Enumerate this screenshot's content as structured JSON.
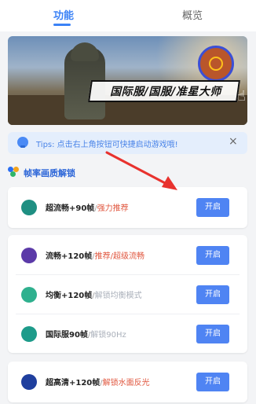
{
  "tabs": {
    "function": "功能",
    "overview": "概览"
  },
  "banner": {
    "title": "国际服/国服/准星大师"
  },
  "tips": {
    "text": "Tips: 点击右上角按钮可快捷启动游戏哦!",
    "close": "×"
  },
  "section": {
    "title": "帧率画质解锁"
  },
  "items": [
    {
      "name": "超流畅+90帧",
      "desc": "强力推荐",
      "desc_style": "hot",
      "button": "开启",
      "color": "#1f8f82"
    },
    {
      "name": "流畅+120帧",
      "desc": "推荐/超级流畅",
      "desc_style": "hot",
      "button": "开启",
      "color": "#5b3aa8"
    },
    {
      "name": "均衡+120帧",
      "desc": "解锁均衡模式",
      "desc_style": "muted",
      "button": "开启",
      "color": "#2fb08e"
    },
    {
      "name": "国际服90帧",
      "desc": "解锁90Hz",
      "desc_style": "muted",
      "button": "开启",
      "color": "#1d9b8a"
    },
    {
      "name": "超高清+120帧",
      "desc": "解锁水面反光",
      "desc_style": "hot",
      "button": "开启",
      "color": "#1f3f9e"
    }
  ],
  "colors": {
    "accent": "#3b82f6",
    "button": "#4f84f3",
    "hot": "#e0563e",
    "arrow": "#e8322e"
  }
}
